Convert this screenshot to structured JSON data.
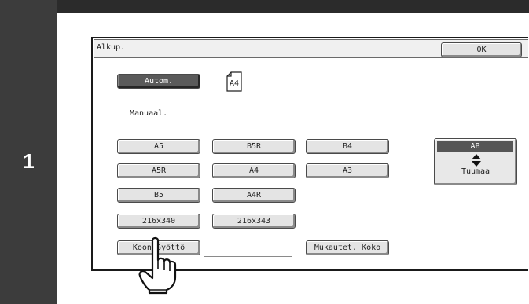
{
  "step": {
    "number": "1"
  },
  "panel": {
    "title": "Alkup.",
    "ok_label": "OK",
    "auto_label": "Autom.",
    "detected_size": "A4",
    "manual_label": "Manuaal.",
    "sizes": [
      "A5",
      "B5R",
      "B4",
      "A5R",
      "A4",
      "A3",
      "B5",
      "A4R",
      "216x340",
      "216x343"
    ],
    "size_input_label": "Koon Syöttö",
    "custom_size_label": "Mukautet. Koko",
    "units": {
      "metric": "AB",
      "imperial": "Tuumaa"
    }
  }
}
